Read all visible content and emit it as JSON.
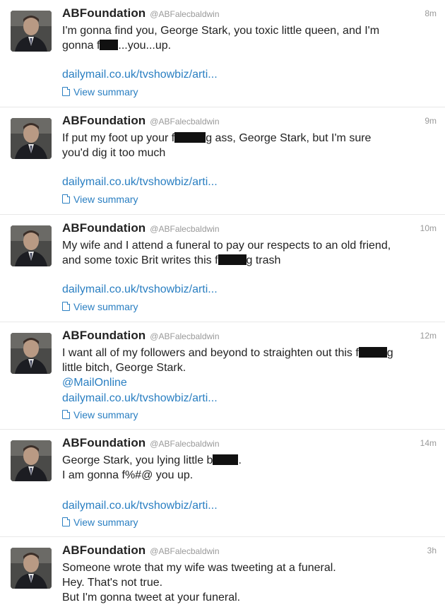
{
  "tweets": [
    {
      "name": "ABFoundation",
      "handle": "@ABFalecbaldwin",
      "time": "8m",
      "lines": [
        {
          "a": "I'm gonna find you, George Stark, you toxic little queen, and I'm",
          "b": ""
        },
        {
          "a": "gonna f",
          "b": "...you...up."
        }
      ],
      "link": "dailymail.co.uk/tvshowbiz/arti...",
      "summary": "View summary"
    },
    {
      "name": "ABFoundation",
      "handle": "@ABFalecbaldwin",
      "time": "9m",
      "lines": [
        {
          "a": "If put my foot up your f",
          "b": "g ass, George Stark, but I'm sure"
        },
        {
          "a": "you'd dig it too much",
          "b": ""
        }
      ],
      "link": "dailymail.co.uk/tvshowbiz/arti...",
      "summary": "View summary"
    },
    {
      "name": "ABFoundation",
      "handle": "@ABFalecbaldwin",
      "time": "10m",
      "lines": [
        {
          "a": "My wife and I attend a funeral to pay our respects to an old friend,",
          "b": ""
        },
        {
          "a": "and some toxic Brit writes this f",
          "b": "g trash"
        }
      ],
      "link": "dailymail.co.uk/tvshowbiz/arti...",
      "summary": "View summary"
    },
    {
      "name": "ABFoundation",
      "handle": "@ABFalecbaldwin",
      "time": "12m",
      "lines": [
        {
          "a": "I want all of my followers and beyond to straighten out this f",
          "b": "g"
        },
        {
          "a": "little bitch, George Stark.",
          "b": ""
        }
      ],
      "mention": "@MailOnline",
      "link": "dailymail.co.uk/tvshowbiz/arti...",
      "summary": "View summary"
    },
    {
      "name": "ABFoundation",
      "handle": "@ABFalecbaldwin",
      "time": "14m",
      "lines": [
        {
          "a": "George Stark, you lying little b",
          "b": "."
        },
        {
          "a": "I am gonna f%#@ you up.",
          "b": ""
        }
      ],
      "link": "dailymail.co.uk/tvshowbiz/arti...",
      "summary": "View summary"
    },
    {
      "name": "ABFoundation",
      "handle": "@ABFalecbaldwin",
      "time": "3h",
      "lines": [
        {
          "a": "Someone wrote that my wife was tweeting at a funeral.",
          "b": ""
        },
        {
          "a": "Hey. That's not true.",
          "b": ""
        },
        {
          "a": "But I'm gonna tweet at your funeral.",
          "b": ""
        }
      ]
    }
  ]
}
